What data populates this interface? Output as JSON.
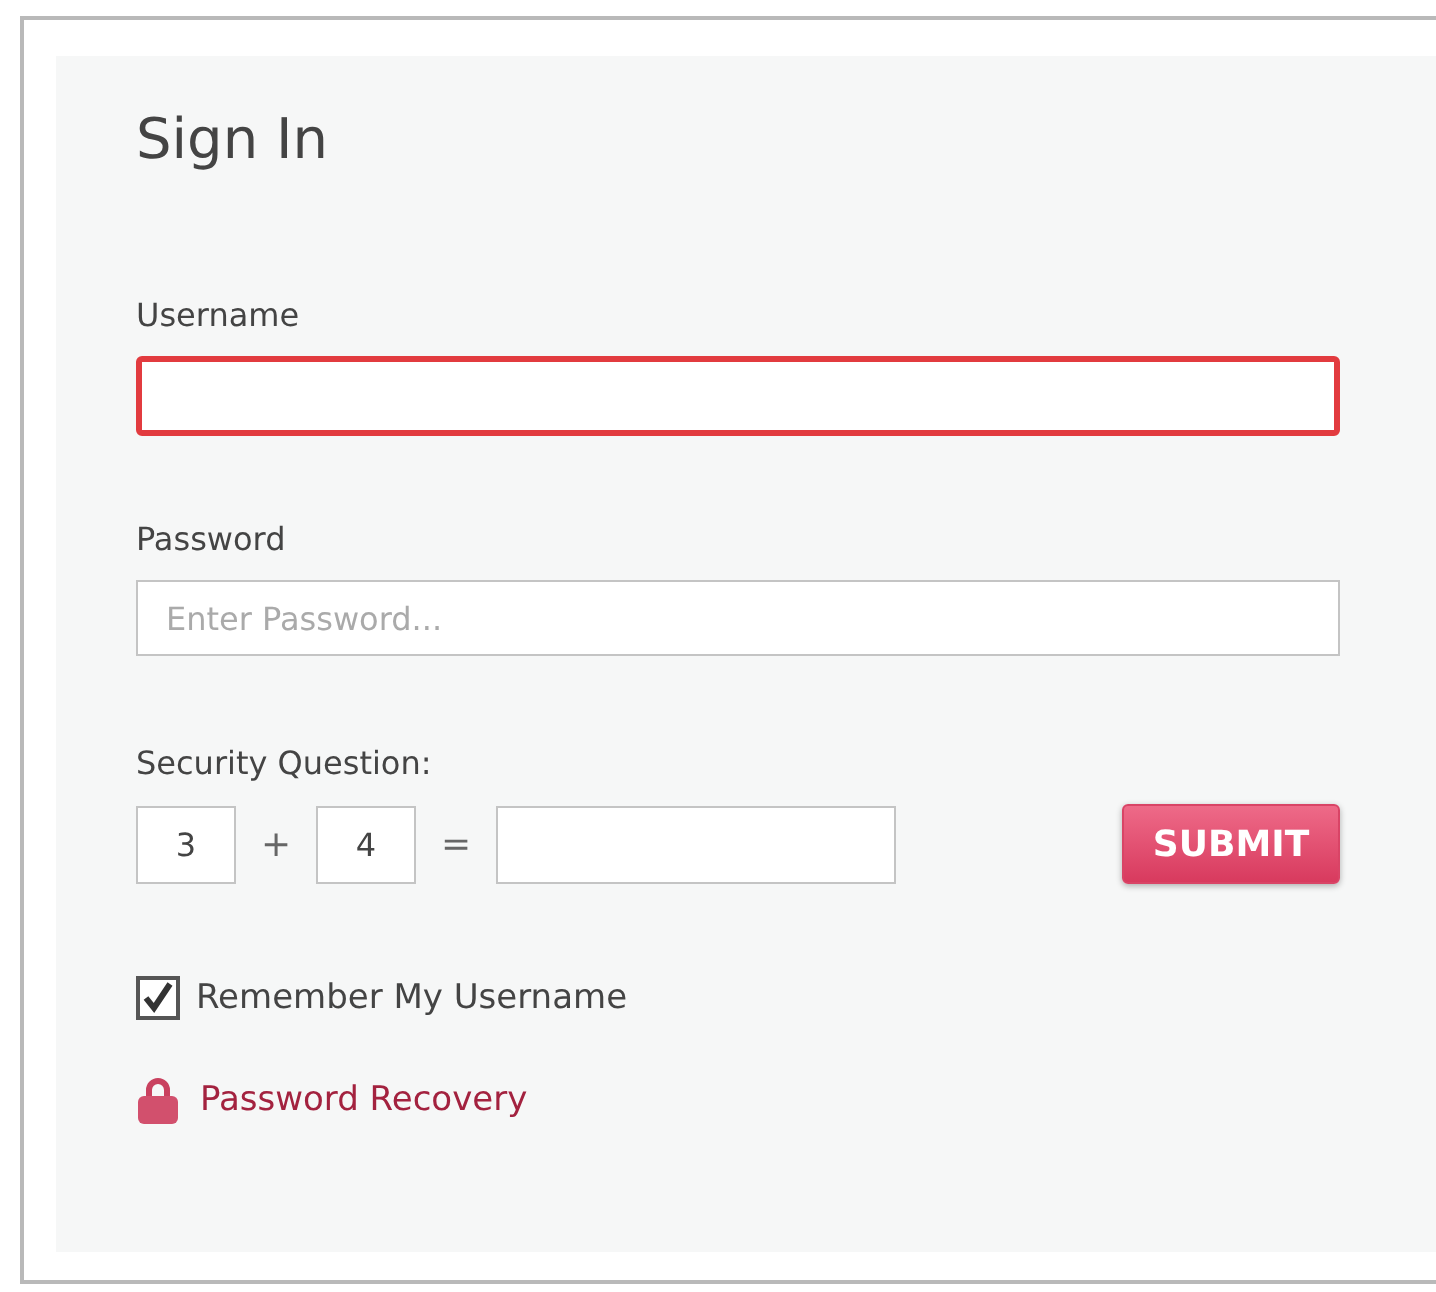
{
  "title": "Sign In",
  "username": {
    "label": "Username",
    "error": true
  },
  "password": {
    "label": "Password",
    "placeholder": "Enter Password...",
    "error": false
  },
  "security": {
    "label": "Security Question:",
    "operand_1": "3",
    "operator": "+",
    "operand_2": "4",
    "equals": "="
  },
  "submit": {
    "label": "SUBMIT"
  },
  "remember": {
    "label": "Remember My Username",
    "checked": true
  },
  "recovery": {
    "label": "Password Recovery"
  }
}
